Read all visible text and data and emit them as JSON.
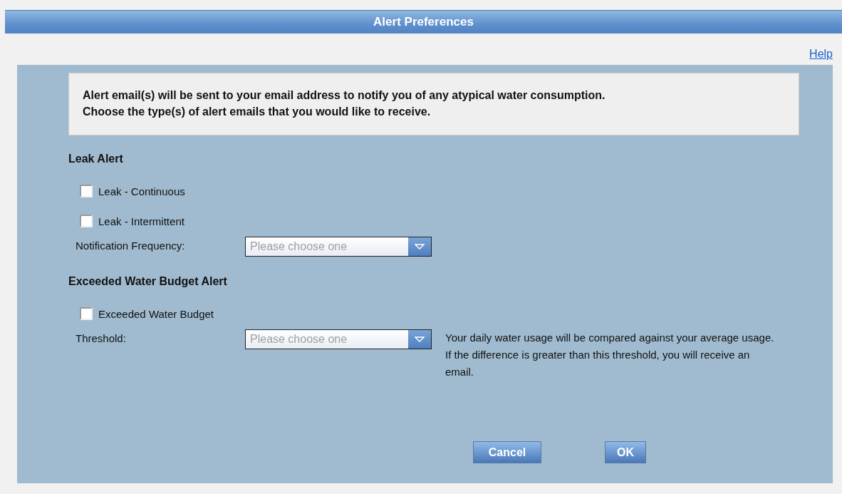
{
  "window": {
    "title": "Alert Preferences"
  },
  "help_link": "Help",
  "intro": [
    "Alert email(s) will be sent to your email address to notify you of any atypical water consumption.",
    "Choose the type(s) of alert emails that you would like to receive."
  ],
  "sections": [
    {
      "heading": "Leak Alert",
      "items": [
        {
          "kind": "checkbox",
          "label": "Leak - Continuous",
          "checked": false
        },
        {
          "kind": "checkbox",
          "label": "Leak - Intermittent",
          "checked": false
        },
        {
          "kind": "select",
          "label": "Notification Frequency:",
          "placeholder": "Please choose one"
        }
      ]
    },
    {
      "heading": "Exceeded Water Budget Alert",
      "items": [
        {
          "kind": "checkbox",
          "label": "Exceeded Water Budget",
          "checked": false
        },
        {
          "kind": "select",
          "label": "Threshold:",
          "placeholder": "Please choose one",
          "hint": "Your daily water usage will be compared against your average usage. If the difference is greater than this threshold, you will receive an email."
        }
      ]
    }
  ],
  "buttons": [
    "Cancel",
    "OK"
  ]
}
